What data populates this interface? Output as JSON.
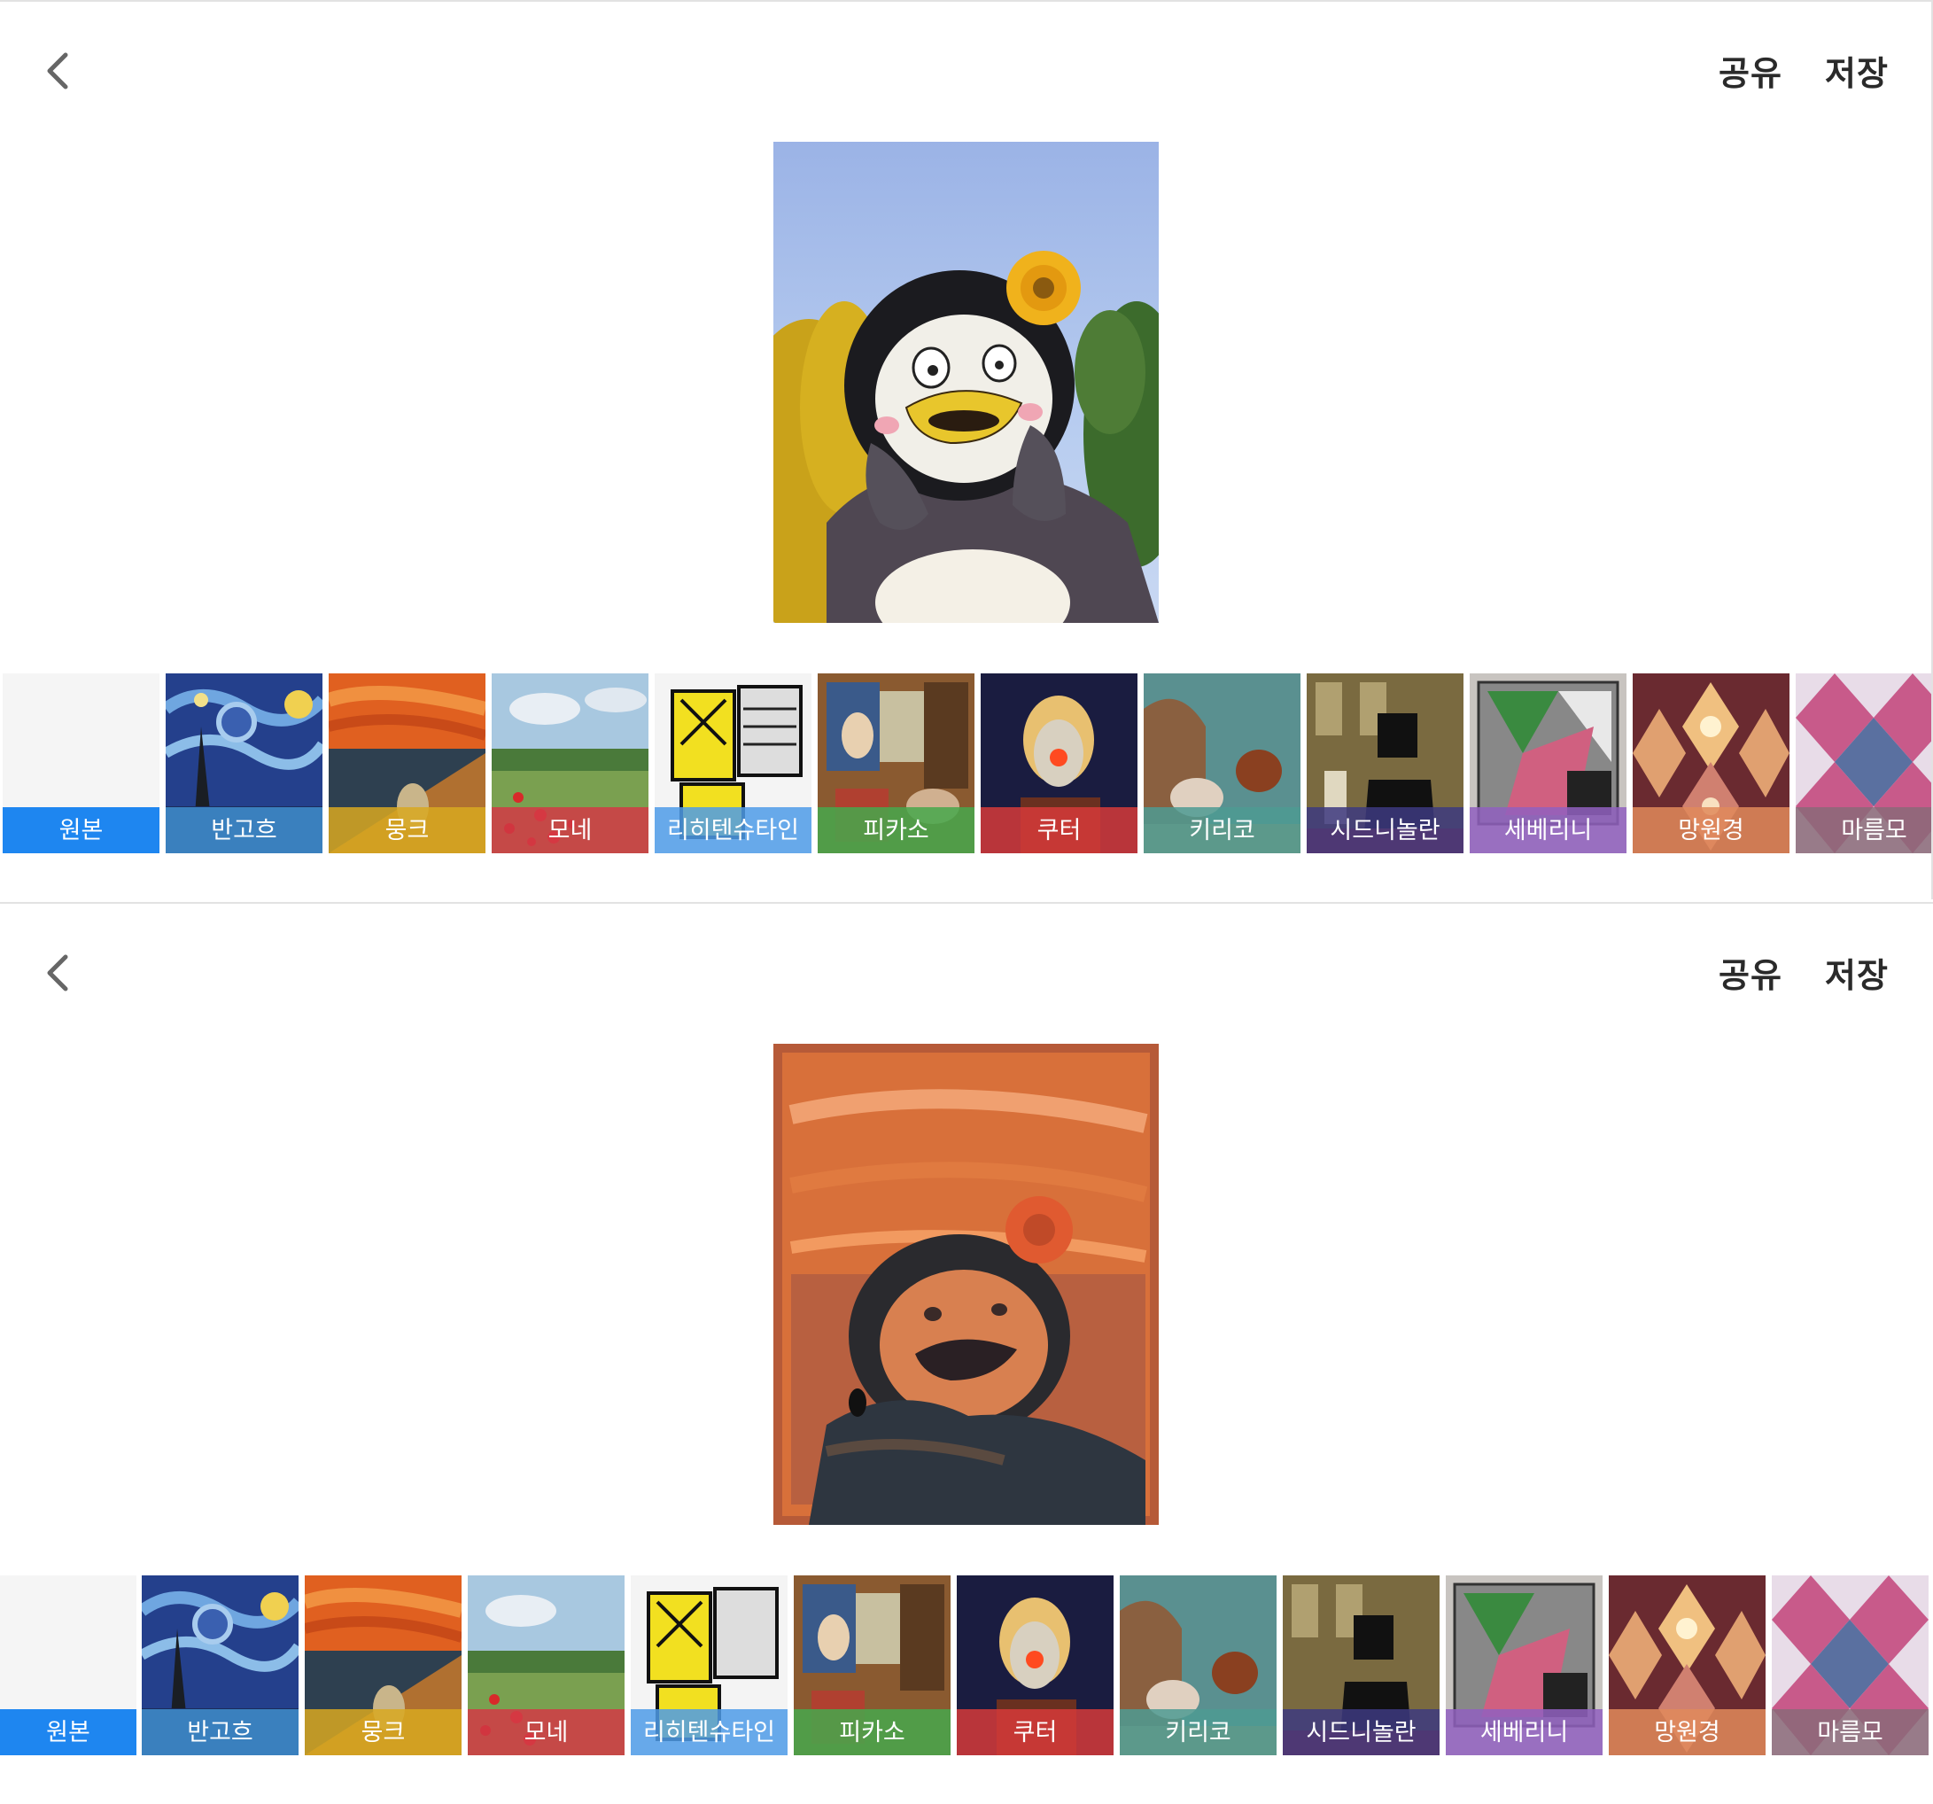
{
  "screens": [
    {
      "header": {
        "back_icon": "chevron-left-icon",
        "share_label": "공유",
        "save_label": "저장"
      },
      "preview": {
        "subject": "penguin mascot photo",
        "style": "original"
      },
      "filters": [
        "원본",
        "반고흐",
        "뭉크",
        "모네",
        "리히텐슈타인",
        "피카소",
        "쿠터",
        "키리코",
        "시드니놀란",
        "세베리니",
        "망원경",
        "마름모"
      ],
      "selected_filter": "원본"
    },
    {
      "header": {
        "back_icon": "chevron-left-icon",
        "share_label": "공유",
        "save_label": "저장"
      },
      "preview": {
        "subject": "penguin mascot photo",
        "style": "munch"
      },
      "filters": [
        "원본",
        "반고흐",
        "뭉크",
        "모네",
        "리히텐슈타인",
        "피카소",
        "쿠터",
        "키리코",
        "시드니놀란",
        "세베리니",
        "망원경",
        "마름모"
      ],
      "selected_filter": "뭉크"
    }
  ],
  "colors": {
    "original_label": "#1e86f0",
    "vangogh_label": "#3f8fd0",
    "munch_label": "#d8a820",
    "monet_label": "#d23a45",
    "lichtenstein_label": "#4e9be8",
    "picasso_label": "#46a84c",
    "kuter_label": "#d63a3a",
    "chirico_label": "#4d9b93",
    "nolan_label": "#3d3a80",
    "severini_label": "#9060c0",
    "telescope_label": "#e08a5a",
    "diamond_label": "#8a6a78"
  }
}
